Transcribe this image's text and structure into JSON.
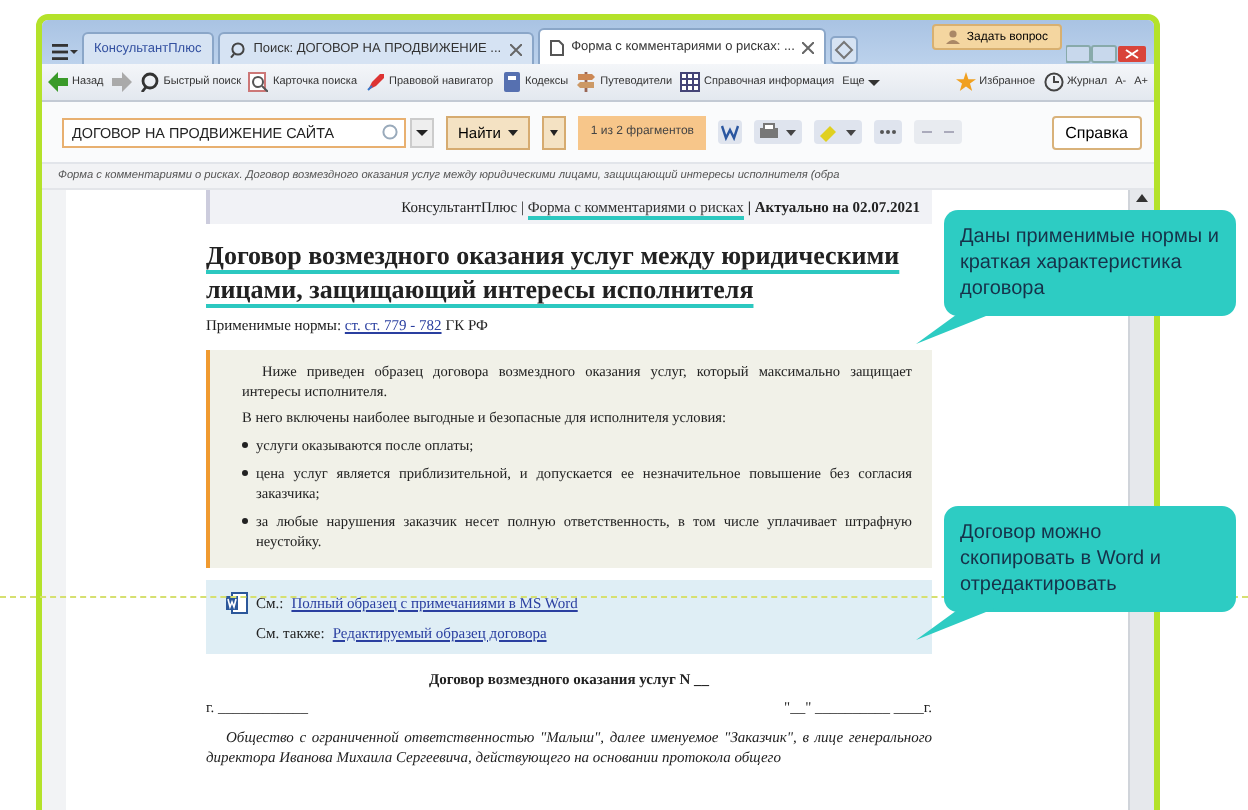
{
  "window": {
    "tabs": [
      {
        "label": "КонсультантПлюс",
        "selected": false
      },
      {
        "label": "Поиск: ДОГОВОР НА ПРОДВИЖЕНИЕ ...",
        "selected": false
      },
      {
        "label": "Форма с комментариями о рисках: ...",
        "selected": true
      }
    ],
    "ask_button": "Задать вопрос"
  },
  "toolbar": [
    {
      "label": "Назад"
    },
    {
      "label": "Быстрый поиск"
    },
    {
      "label": "Карточка поиска"
    },
    {
      "label": "Правовой навигатор"
    },
    {
      "label": "Кодексы"
    },
    {
      "label": "Путеводители"
    },
    {
      "label": "Справочная информация"
    },
    {
      "label": "Еще"
    }
  ],
  "toolbar_right": [
    {
      "label": "Избранное"
    },
    {
      "label": "Журнал"
    },
    {
      "label": "А-"
    },
    {
      "label": "А+"
    }
  ],
  "search": {
    "value": "ДОГОВОР НА ПРОДВИЖЕНИЕ САЙТА",
    "find_button": "Найти",
    "result": "1 из 2 фрагментов"
  },
  "help_button": "Справка",
  "breadcrumb": "Форма с комментариями о рисках. Договор возмездного оказания услуг между юридическими лицами, защищающий интересы исполнителя (обра",
  "document": {
    "header": {
      "source": "КонсультантПлюс |",
      "link": "Форма с комментариями о рисках",
      "actual": "| Актуально на 02.07.2021"
    },
    "title": "Договор возмездного оказания услуг между юридическими лицами, защищающий интересы исполнителя",
    "norms": {
      "label": "Применимые нормы:",
      "link": "ст. ст. 779 - 782",
      "suffix": "ГК РФ"
    },
    "note": {
      "paragraphs": [
        "Ниже приведен образец договора возмездного оказания услуг, который максимально защищает интересы исполнителя.",
        "В него включены наиболее выгодные и безопасные для исполнителя условия:"
      ],
      "bullets": [
        "услуги оказываются после оплаты;",
        "цена услуг является приблизительной, и допускается ее незначительное повышение без согласия заказчика;",
        "за любые нарушения заказчик несет полную ответственность, в том числе уплачивает штрафную неустойку."
      ]
    },
    "see": [
      {
        "label": "См.:",
        "link": "Полный образец с примечаниями в MS Word"
      },
      {
        "label": "См. также:",
        "link": "Редактируемый образец договора"
      }
    ],
    "contract_title": "Договор возмездного оказания услуг N __",
    "place_line": "г. ____________",
    "date_line": "\"__\" __________ ____г.",
    "intro": "Общество с ограниченной ответственностью \"Малыш\", далее именуемое \"Заказчик\", в лице генерального директора Иванова Михаила Сергеевича, действующего на основании протокола общего"
  },
  "callouts": [
    {
      "text": "Даны применимые нормы и краткая характеристика договора"
    },
    {
      "text": "Договор можно скопировать в Word и отредактировать"
    }
  ]
}
